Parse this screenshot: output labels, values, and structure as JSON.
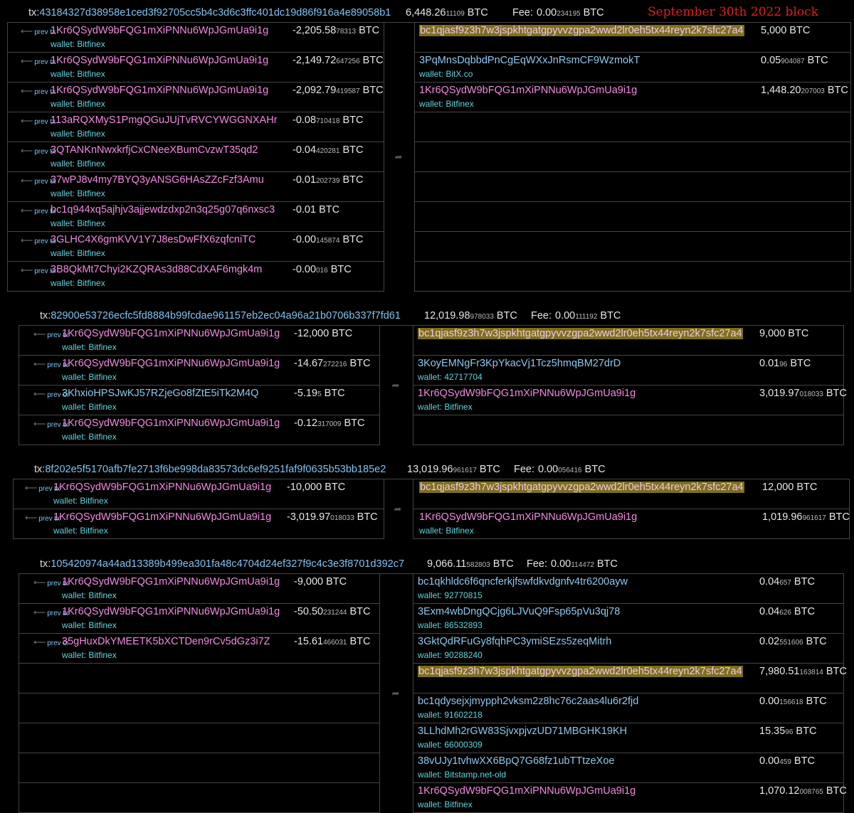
{
  "annotation": "September 30th 2022 block",
  "arrow_glyph": "➦",
  "prev_label": "prev tx",
  "prev_arrow": "⟵",
  "btc": "BTC",
  "tx_prefix": "tx:",
  "fee_label": "Fee:",
  "wallet_prefix": "wallet: ",
  "transactions": [
    {
      "txid": "43184327d38958e1ced3f92705cc5b4c3d6c3ffc401dc19d86f916a4e89058b1",
      "total_main": "6,448.26",
      "total_small": "11109",
      "fee_main": "0.00",
      "fee_small": "234195",
      "inputs": [
        {
          "address": "1Kr6QSydW9bFQG1mXiPNNu6WpJGmUa9i1g",
          "wallet": "Bitfinex",
          "amt_main": "-2,205.58",
          "amt_small": "78313"
        },
        {
          "address": "1Kr6QSydW9bFQG1mXiPNNu6WpJGmUa9i1g",
          "wallet": "Bitfinex",
          "amt_main": "-2,149.72",
          "amt_small": "647256"
        },
        {
          "address": "1Kr6QSydW9bFQG1mXiPNNu6WpJGmUa9i1g",
          "wallet": "Bitfinex",
          "amt_main": "-2,092.79",
          "amt_small": "419587"
        },
        {
          "address": "113aRQXMyS1PmgQGuJUjTvRVCYWGGNXAHr",
          "wallet": "Bitfinex",
          "amt_main": "-0.08",
          "amt_small": "710418"
        },
        {
          "address": "3QTANKnNwxkrfjCxCNeeXBumCvzwT35qd2",
          "wallet": "Bitfinex",
          "amt_main": "-0.04",
          "amt_small": "420281"
        },
        {
          "address": "37wPJ8v4my7BYQ3yANSG6HAsZZcFzf3Amu",
          "wallet": "Bitfinex",
          "amt_main": "-0.01",
          "amt_small": "202739"
        },
        {
          "address": "bc1q944xq5ajhjv3ajjewdzdxp2n3q25g07q6nxsc3",
          "wallet": "Bitfinex",
          "amt_main": "-0.01",
          "amt_small": ""
        },
        {
          "address": "3GLHC4X6gmKVV1Y7J8esDwFfX6zqfcniTC",
          "wallet": "Bitfinex",
          "amt_main": "-0.00",
          "amt_small": "145874"
        },
        {
          "address": "3B8QkMt7Chyi2KZQRAs3d88CdXAF6mgk4m",
          "wallet": "Bitfinex",
          "amt_main": "-0.00",
          "amt_small": "016"
        }
      ],
      "outputs": [
        {
          "address": "bc1qjasf9z3h7w3jspkhtgatgpyvvzgpa2wwd2lr0eh5tx44reyn2k7sfc27a4",
          "wallet": "",
          "amt_main": "5,000",
          "amt_small": "",
          "hl": true
        },
        {
          "address": "3PqMnsDqbbdPnCgEqWXxJnRsmCF9WzmokT",
          "wallet": "BitX.co",
          "amt_main": "0.05",
          "amt_small": "904087",
          "blue": true
        },
        {
          "address": "1Kr6QSydW9bFQG1mXiPNNu6WpJGmUa9i1g",
          "wallet": "Bitfinex",
          "amt_main": "1,448.20",
          "amt_small": "207003"
        }
      ]
    },
    {
      "txid": "82900e53726ecfc5fd8884b99fcdae961157eb2ec04a96a21b0706b337f7fd61",
      "total_main": "12,019.98",
      "total_small": "978033",
      "fee_main": "0.00",
      "fee_small": "111192",
      "inputs": [
        {
          "address": "1Kr6QSydW9bFQG1mXiPNNu6WpJGmUa9i1g",
          "wallet": "Bitfinex",
          "amt_main": "-12,000",
          "amt_small": ""
        },
        {
          "address": "1Kr6QSydW9bFQG1mXiPNNu6WpJGmUa9i1g",
          "wallet": "Bitfinex",
          "amt_main": "-14.67",
          "amt_small": "272216"
        },
        {
          "address": "3KhxioHPSJwKJ57RZjeGo8fZtE5iTk2M4Q",
          "wallet": "Bitfinex",
          "amt_main": "-5.19",
          "amt_small": "5",
          "blue": true
        },
        {
          "address": "1Kr6QSydW9bFQG1mXiPNNu6WpJGmUa9i1g",
          "wallet": "Bitfinex",
          "amt_main": "-0.12",
          "amt_small": "317009"
        }
      ],
      "outputs": [
        {
          "address": "bc1qjasf9z3h7w3jspkhtgatgpyvvzgpa2wwd2lr0eh5tx44reyn2k7sfc27a4",
          "wallet": "",
          "amt_main": "9,000",
          "amt_small": "",
          "hl": true
        },
        {
          "address": "3KoyEMNgFr3KpYkacVj1Tcz5hmqBM27drD",
          "wallet": "42717704",
          "amt_main": "0.01",
          "amt_small": "96",
          "blue": true
        },
        {
          "address": "1Kr6QSydW9bFQG1mXiPNNu6WpJGmUa9i1g",
          "wallet": "Bitfinex",
          "amt_main": "3,019.97",
          "amt_small": "018033"
        }
      ]
    },
    {
      "txid": "8f202e5f5170afb7fe2713f6be998da83573dc6ef9251faf9f0635b53bb185e2",
      "total_main": "13,019.96",
      "total_small": "961617",
      "fee_main": "0.00",
      "fee_small": "056416",
      "inputs": [
        {
          "address": "1Kr6QSydW9bFQG1mXiPNNu6WpJGmUa9i1g",
          "wallet": "Bitfinex",
          "amt_main": "-10,000",
          "amt_small": ""
        },
        {
          "address": "1Kr6QSydW9bFQG1mXiPNNu6WpJGmUa9i1g",
          "wallet": "Bitfinex",
          "amt_main": "-3,019.97",
          "amt_small": "018033"
        }
      ],
      "outputs": [
        {
          "address": "bc1qjasf9z3h7w3jspkhtgatgpyvvzgpa2wwd2lr0eh5tx44reyn2k7sfc27a4",
          "wallet": "",
          "amt_main": "12,000",
          "amt_small": "",
          "hl": true
        },
        {
          "address": "1Kr6QSydW9bFQG1mXiPNNu6WpJGmUa9i1g",
          "wallet": "Bitfinex",
          "amt_main": "1,019.96",
          "amt_small": "961617"
        }
      ]
    },
    {
      "txid": "105420974a44ad13389b499ea301fa48c4704d24ef327f9c4c3e3f8701d392c7",
      "total_main": "9,066.11",
      "total_small": "582803",
      "fee_main": "0.00",
      "fee_small": "114472",
      "inputs": [
        {
          "address": "1Kr6QSydW9bFQG1mXiPNNu6WpJGmUa9i1g",
          "wallet": "Bitfinex",
          "amt_main": "-9,000",
          "amt_small": ""
        },
        {
          "address": "1Kr6QSydW9bFQG1mXiPNNu6WpJGmUa9i1g",
          "wallet": "Bitfinex",
          "amt_main": "-50.50",
          "amt_small": "231244"
        },
        {
          "address": "35gHuxDkYMEETK5bXCTDen9rCv5dGz3i7Z",
          "wallet": "Bitfinex",
          "amt_main": "-15.61",
          "amt_small": "466031"
        }
      ],
      "outputs": [
        {
          "address": "bc1qkhldc6f6qncferkjfswfdkvdgnfv4tr6200ayw",
          "wallet": "92770815",
          "amt_main": "0.04",
          "amt_small": "657",
          "blue": true
        },
        {
          "address": "3Exm4wbDngQCjg6LJVuQ9Fsp65pVu3qj78",
          "wallet": "86532893",
          "amt_main": "0.04",
          "amt_small": "626",
          "blue": true
        },
        {
          "address": "3GktQdRFuGy8fqhPC3ymiSEzs5zeqMitrh",
          "wallet": "90288240",
          "amt_main": "0.02",
          "amt_small": "551606",
          "blue": true
        },
        {
          "address": "bc1qjasf9z3h7w3jspkhtgatgpyvvzgpa2wwd2lr0eh5tx44reyn2k7sfc27a4",
          "wallet": "",
          "amt_main": "7,980.51",
          "amt_small": "163814",
          "hl": true
        },
        {
          "address": "bc1qdysejxjmypph2vksm2z8hc76c2aas4lu6r2fjd",
          "wallet": "91602218",
          "amt_main": "0.00",
          "amt_small": "156618",
          "blue": true
        },
        {
          "address": "3LLhdMh2rGW83SjvxpjvzUD71MBGHK19KH",
          "wallet": "66000309",
          "amt_main": "15.35",
          "amt_small": "96",
          "blue": true
        },
        {
          "address": "38vUJy1tvhwXX6BpQ7G68fz1ubTTtzeXoe",
          "wallet": "Bitstamp.net-old",
          "amt_main": "0.00",
          "amt_small": "459",
          "blue": true
        },
        {
          "address": "1Kr6QSydW9bFQG1mXiPNNu6WpJGmUa9i1g",
          "wallet": "Bitfinex",
          "amt_main": "1,070.12",
          "amt_small": "008765"
        }
      ]
    }
  ]
}
